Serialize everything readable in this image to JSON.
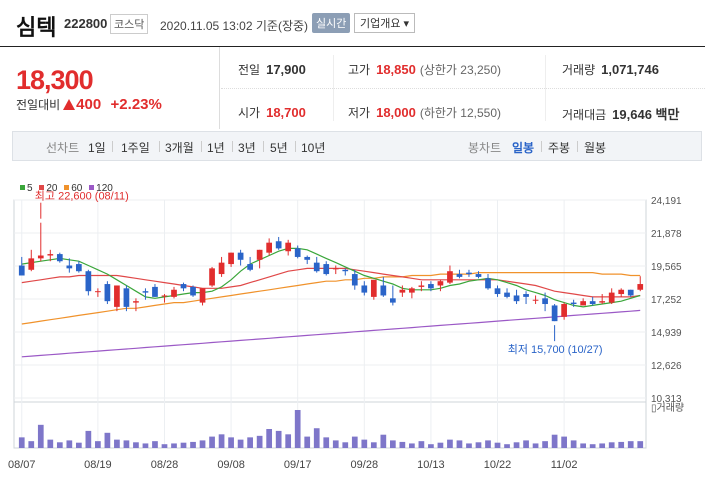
{
  "header": {
    "name": "심텍",
    "code": "222800",
    "market": "코스닥",
    "timestamp": "2020.11.05 13:02 기준(장중)",
    "realtime_label": "실시간",
    "overview_label": "기업개요 ▾"
  },
  "price": {
    "current": "18,300",
    "change_label": "전일대비",
    "change_amount": "400",
    "change_pct": "+2.23%",
    "up_color": "#e12d2d"
  },
  "stats": {
    "prev_close_label": "전일",
    "prev_close": "17,900",
    "high_label": "고가",
    "high": "18,850",
    "upper_limit": "(상한가 23,250)",
    "volume_label": "거래량",
    "volume": "1,071,746",
    "open_label": "시가",
    "open": "18,700",
    "low_label": "저가",
    "low": "18,000",
    "lower_limit": "(하한가 12,550)",
    "trade_value_label": "거래대금",
    "trade_value": "19,646 백만"
  },
  "tabs": {
    "line_label": "선차트",
    "line_items": [
      "1일",
      "1주일",
      "3개월",
      "1년",
      "3년",
      "5년",
      "10년"
    ],
    "candle_label": "봉차트",
    "candle_items": [
      "일봉",
      "주봉",
      "월봉"
    ],
    "candle_active": "일봉"
  },
  "chart_data": {
    "type": "candlestick",
    "legend": [
      {
        "name": "5",
        "color": "#3aa63a"
      },
      {
        "name": "20",
        "color": "#e04848"
      },
      {
        "name": "60",
        "color": "#f0922b"
      },
      {
        "name": "120",
        "color": "#9b59c6"
      }
    ],
    "y_ticks": [
      "24,191",
      "21,878",
      "19,565",
      "17,252",
      "14,939",
      "12,626",
      "10,313"
    ],
    "ylim": [
      10313,
      24191
    ],
    "x_ticks": [
      "08/07",
      "08/19",
      "08/28",
      "09/08",
      "09/17",
      "09/28",
      "10/13",
      "10/22",
      "11/02"
    ],
    "x_tick_index": [
      0,
      8,
      15,
      22,
      29,
      36,
      43,
      50,
      57
    ],
    "high_annotation": "최고 22,600 (08/11)",
    "low_annotation": "최저 15,700 (10/27)",
    "volume_label": "거래량",
    "up_color": "#e12d2d",
    "down_color": "#2a64c8",
    "candles": [
      {
        "o": 19600,
        "h": 20200,
        "l": 18900,
        "c": 18900
      },
      {
        "o": 19300,
        "h": 20700,
        "l": 19200,
        "c": 20100
      },
      {
        "o": 20100,
        "h": 22600,
        "l": 19900,
        "c": 20300
      },
      {
        "o": 20300,
        "h": 20700,
        "l": 19900,
        "c": 20400
      },
      {
        "o": 20400,
        "h": 20500,
        "l": 19800,
        "c": 19900
      },
      {
        "o": 19600,
        "h": 20100,
        "l": 19100,
        "c": 19400
      },
      {
        "o": 19700,
        "h": 19900,
        "l": 19100,
        "c": 19200
      },
      {
        "o": 19200,
        "h": 19300,
        "l": 17500,
        "c": 17800
      },
      {
        "o": 17800,
        "h": 18000,
        "l": 17400,
        "c": 17800
      },
      {
        "o": 18300,
        "h": 18500,
        "l": 16900,
        "c": 17100
      },
      {
        "o": 16700,
        "h": 18200,
        "l": 16400,
        "c": 18200
      },
      {
        "o": 18000,
        "h": 18200,
        "l": 16400,
        "c": 16700
      },
      {
        "o": 17000,
        "h": 17300,
        "l": 16400,
        "c": 17100
      },
      {
        "o": 17800,
        "h": 18000,
        "l": 17200,
        "c": 17700
      },
      {
        "o": 18100,
        "h": 18300,
        "l": 17400,
        "c": 17400
      },
      {
        "o": 17500,
        "h": 17600,
        "l": 17000,
        "c": 17500
      },
      {
        "o": 17400,
        "h": 18100,
        "l": 17300,
        "c": 17900
      },
      {
        "o": 18300,
        "h": 18400,
        "l": 17800,
        "c": 18000
      },
      {
        "o": 18100,
        "h": 18200,
        "l": 17400,
        "c": 17500
      },
      {
        "o": 17000,
        "h": 18000,
        "l": 16800,
        "c": 18000
      },
      {
        "o": 18200,
        "h": 19500,
        "l": 18100,
        "c": 19400
      },
      {
        "o": 19000,
        "h": 20200,
        "l": 18800,
        "c": 19800
      },
      {
        "o": 19700,
        "h": 20500,
        "l": 19500,
        "c": 20500
      },
      {
        "o": 20500,
        "h": 20700,
        "l": 19600,
        "c": 20000
      },
      {
        "o": 19700,
        "h": 20200,
        "l": 19200,
        "c": 19300
      },
      {
        "o": 20000,
        "h": 20700,
        "l": 19400,
        "c": 20700
      },
      {
        "o": 20500,
        "h": 21500,
        "l": 20300,
        "c": 21200
      },
      {
        "o": 21300,
        "h": 21600,
        "l": 20700,
        "c": 20800
      },
      {
        "o": 20600,
        "h": 21400,
        "l": 20300,
        "c": 21200
      },
      {
        "o": 20800,
        "h": 21000,
        "l": 20100,
        "c": 20200
      },
      {
        "o": 20200,
        "h": 20300,
        "l": 19700,
        "c": 20000
      },
      {
        "o": 19800,
        "h": 20200,
        "l": 19100,
        "c": 19200
      },
      {
        "o": 19700,
        "h": 19900,
        "l": 18900,
        "c": 19000
      },
      {
        "o": 19400,
        "h": 19600,
        "l": 19000,
        "c": 19400
      },
      {
        "o": 19300,
        "h": 19400,
        "l": 18900,
        "c": 19200
      },
      {
        "o": 19000,
        "h": 19300,
        "l": 17900,
        "c": 18200
      },
      {
        "o": 18200,
        "h": 18500,
        "l": 17500,
        "c": 17700
      },
      {
        "o": 17400,
        "h": 18600,
        "l": 17200,
        "c": 18600
      },
      {
        "o": 18200,
        "h": 18800,
        "l": 17400,
        "c": 17500
      },
      {
        "o": 17300,
        "h": 18200,
        "l": 16800,
        "c": 17000
      },
      {
        "o": 17700,
        "h": 18200,
        "l": 17400,
        "c": 17900
      },
      {
        "o": 17700,
        "h": 18100,
        "l": 17300,
        "c": 18000
      },
      {
        "o": 18100,
        "h": 18500,
        "l": 17800,
        "c": 18200
      },
      {
        "o": 18300,
        "h": 18500,
        "l": 17800,
        "c": 18000
      },
      {
        "o": 18200,
        "h": 18600,
        "l": 17800,
        "c": 18500
      },
      {
        "o": 18400,
        "h": 19600,
        "l": 18300,
        "c": 19200
      },
      {
        "o": 19000,
        "h": 19300,
        "l": 18700,
        "c": 18800
      },
      {
        "o": 19100,
        "h": 19300,
        "l": 18800,
        "c": 19000
      },
      {
        "o": 19000,
        "h": 19200,
        "l": 18700,
        "c": 18800
      },
      {
        "o": 18700,
        "h": 19000,
        "l": 17900,
        "c": 18000
      },
      {
        "o": 18000,
        "h": 18200,
        "l": 17400,
        "c": 17600
      },
      {
        "o": 17700,
        "h": 18000,
        "l": 17300,
        "c": 17400
      },
      {
        "o": 17500,
        "h": 17900,
        "l": 16900,
        "c": 17100
      },
      {
        "o": 17600,
        "h": 17800,
        "l": 16900,
        "c": 17400
      },
      {
        "o": 17200,
        "h": 17500,
        "l": 16900,
        "c": 17200
      },
      {
        "o": 17300,
        "h": 17700,
        "l": 16400,
        "c": 16900
      },
      {
        "o": 16800,
        "h": 16900,
        "l": 15700,
        "c": 15700
      },
      {
        "o": 16000,
        "h": 17000,
        "l": 15800,
        "c": 16900
      },
      {
        "o": 17000,
        "h": 17200,
        "l": 16700,
        "c": 16900
      },
      {
        "o": 16800,
        "h": 17300,
        "l": 16800,
        "c": 17100
      },
      {
        "o": 17100,
        "h": 17400,
        "l": 16800,
        "c": 16900
      },
      {
        "o": 17000,
        "h": 17600,
        "l": 16900,
        "c": 17100
      },
      {
        "o": 17000,
        "h": 18000,
        "l": 16900,
        "c": 17700
      },
      {
        "o": 17600,
        "h": 18000,
        "l": 17400,
        "c": 17900
      },
      {
        "o": 17900,
        "h": 17900,
        "l": 17400,
        "c": 17500
      },
      {
        "o": 17900,
        "h": 18850,
        "l": 17800,
        "c": 18300
      }
    ],
    "ma5": [
      19700,
      19800,
      19900,
      20000,
      20100,
      20000,
      19900,
      19600,
      19300,
      19000,
      18600,
      18200,
      17800,
      17400,
      17300,
      17400,
      17500,
      17600,
      17700,
      17700,
      17800,
      18100,
      18600,
      19200,
      19700,
      20000,
      20300,
      20600,
      20800,
      20800,
      20700,
      20400,
      20100,
      19800,
      19500,
      19200,
      18900,
      18700,
      18500,
      18300,
      18000,
      17900,
      17900,
      17900,
      18000,
      18200,
      18300,
      18500,
      18600,
      18700,
      18600,
      18400,
      18200,
      17900,
      17700,
      17500,
      17200,
      17000,
      16800,
      16700,
      16800,
      16900,
      17000,
      17100,
      17300,
      17500
    ],
    "ma20": [
      18400,
      18500,
      18600,
      18700,
      18800,
      18800,
      18900,
      18900,
      18900,
      18900,
      18900,
      18800,
      18700,
      18600,
      18500,
      18400,
      18300,
      18200,
      18100,
      18000,
      18000,
      18000,
      18100,
      18200,
      18400,
      18600,
      18800,
      19000,
      19200,
      19300,
      19400,
      19400,
      19400,
      19400,
      19400,
      19300,
      19200,
      19100,
      19000,
      18900,
      18800,
      18700,
      18600,
      18600,
      18600,
      18600,
      18600,
      18600,
      18600,
      18600,
      18600,
      18500,
      18400,
      18300,
      18200,
      18000,
      17800,
      17700,
      17600,
      17500,
      17400,
      17400,
      17400,
      17400,
      17400,
      17500
    ],
    "ma60": [
      15500,
      15600,
      15700,
      15800,
      15900,
      16000,
      16100,
      16200,
      16300,
      16400,
      16500,
      16600,
      16600,
      16700,
      16800,
      16900,
      17000,
      17000,
      17100,
      17200,
      17300,
      17400,
      17500,
      17600,
      17700,
      17800,
      17900,
      18000,
      18100,
      18200,
      18300,
      18400,
      18500,
      18500,
      18600,
      18600,
      18700,
      18700,
      18800,
      18800,
      18800,
      18900,
      18900,
      18900,
      19000,
      19000,
      19000,
      19000,
      19100,
      19100,
      19100,
      19100,
      19100,
      19100,
      19100,
      19100,
      19100,
      19100,
      19100,
      19100,
      19100,
      19000,
      19000,
      19000,
      18900,
      18900
    ],
    "ma120": [
      13200,
      13250,
      13300,
      13350,
      13400,
      13450,
      13500,
      13550,
      13600,
      13650,
      13700,
      13750,
      13800,
      13850,
      13900,
      13950,
      14000,
      14050,
      14100,
      14150,
      14200,
      14250,
      14300,
      14350,
      14400,
      14450,
      14500,
      14550,
      14600,
      14650,
      14700,
      14750,
      14800,
      14850,
      14900,
      14950,
      15000,
      15050,
      15100,
      15150,
      15200,
      15250,
      15300,
      15350,
      15400,
      15450,
      15500,
      15550,
      15600,
      15650,
      15700,
      15750,
      15800,
      15850,
      15900,
      15950,
      16000,
      16050,
      16100,
      16150,
      16200,
      16250,
      16300,
      16350,
      16400,
      16450
    ],
    "volumes": [
      0.28,
      0.18,
      0.61,
      0.22,
      0.15,
      0.2,
      0.14,
      0.45,
      0.18,
      0.4,
      0.22,
      0.2,
      0.15,
      0.12,
      0.18,
      0.1,
      0.12,
      0.14,
      0.16,
      0.2,
      0.3,
      0.36,
      0.28,
      0.22,
      0.28,
      0.32,
      0.5,
      0.45,
      0.36,
      1.0,
      0.3,
      0.52,
      0.28,
      0.2,
      0.15,
      0.3,
      0.22,
      0.15,
      0.35,
      0.2,
      0.16,
      0.12,
      0.18,
      0.1,
      0.14,
      0.22,
      0.2,
      0.12,
      0.15,
      0.2,
      0.14,
      0.1,
      0.15,
      0.2,
      0.12,
      0.18,
      0.35,
      0.3,
      0.2,
      0.12,
      0.1,
      0.12,
      0.15,
      0.16,
      0.18,
      0.18
    ]
  }
}
